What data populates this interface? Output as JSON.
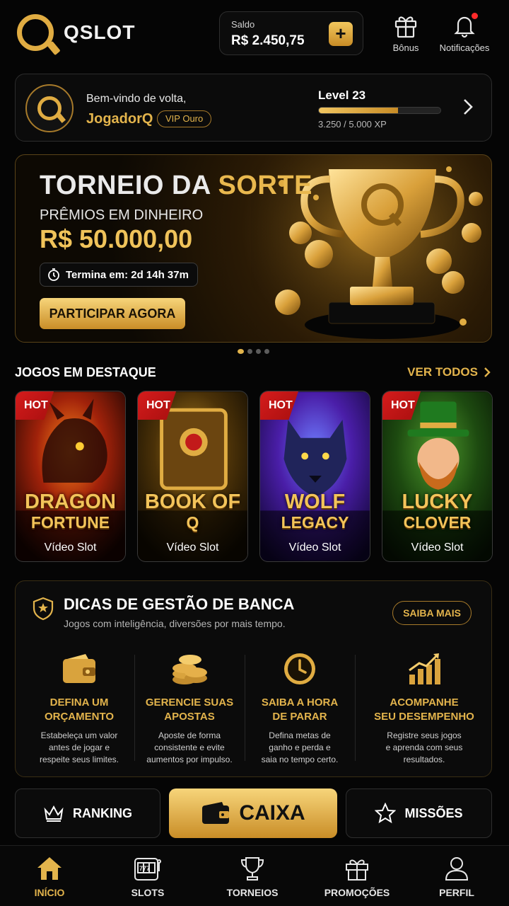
{
  "header": {
    "logo_text": "QSLOT",
    "balance_label": "Saldo",
    "balance_value": "R$ 2.450,75",
    "add_label": "+",
    "bonus_label": "Bônus",
    "notifications_label": "Notificações"
  },
  "welcome": {
    "greeting": "Bem-vindo de volta,",
    "username": "JogadorQ",
    "vip_badge": "VIP Ouro",
    "level": "Level 23",
    "xp_text": "3.250 / 5.000 XP",
    "xp_progress": 0.65
  },
  "banner": {
    "title_part1": "TORNEIO DA",
    "title_part2": "SORTE",
    "subtitle": "PRÊMIOS EM DINHEIRO",
    "prize": "R$ 50.000,00",
    "timer": "Termina em: 2d 14h 37m",
    "cta": "PARTICIPAR AGORA",
    "pages": 4,
    "active_page": 0
  },
  "featured": {
    "title": "JOGOS EM DESTAQUE",
    "see_all": "VER TODOS",
    "games": [
      {
        "badge": "HOT",
        "name1": "DRAGON",
        "name2": "FORTUNE",
        "type": "Vídeo Slot"
      },
      {
        "badge": "HOT",
        "name1": "BOOK OF",
        "name2": "Q",
        "type": "Vídeo Slot"
      },
      {
        "badge": "HOT",
        "name1": "WOLF",
        "name2": "LEGACY",
        "type": "Vídeo Slot"
      },
      {
        "badge": "HOT",
        "name1": "LUCKY",
        "name2": "CLOVER",
        "type": "Vídeo Slot"
      }
    ]
  },
  "tips": {
    "title": "DICAS DE GESTÃO DE BANCA",
    "subtitle": "Jogos com inteligência, diversões por mais tempo.",
    "more": "SAIBA MAIS",
    "items": [
      {
        "icon": "wallet-icon",
        "h1": "DEFINA UM",
        "h2": "ORÇAMENTO",
        "d1": "Estabeleça um valor",
        "d2": "antes de jogar e",
        "d3": "respeite seus limites."
      },
      {
        "icon": "coins-icon",
        "h1": "GERENCIE SUAS",
        "h2": "APOSTAS",
        "d1": "Aposte de forma",
        "d2": "consistente e evite",
        "d3": "aumentos por impulso."
      },
      {
        "icon": "clock-icon",
        "h1": "SAIBA A HORA",
        "h2": "DE PARAR",
        "d1": "Defina metas de",
        "d2": "ganho e perda e",
        "d3": "saia no tempo certo."
      },
      {
        "icon": "chart-up-icon",
        "h1": "ACOMPANHE",
        "h2": "SEU DESEMPENHO",
        "d1": "Registre seus jogos",
        "d2": "e aprenda com seus",
        "d3": "resultados."
      }
    ]
  },
  "actions": {
    "ranking": "RANKING",
    "caixa": "CAIXA",
    "missions": "MISSÕES"
  },
  "nav": {
    "items": [
      "INÍCIO",
      "SLOTS",
      "TORNEIOS",
      "PROMOÇÕES",
      "PERFIL"
    ],
    "active": 0
  },
  "colors": {
    "accent": "#e3b44c",
    "hot": "#d51c1c",
    "background": "#050505"
  }
}
